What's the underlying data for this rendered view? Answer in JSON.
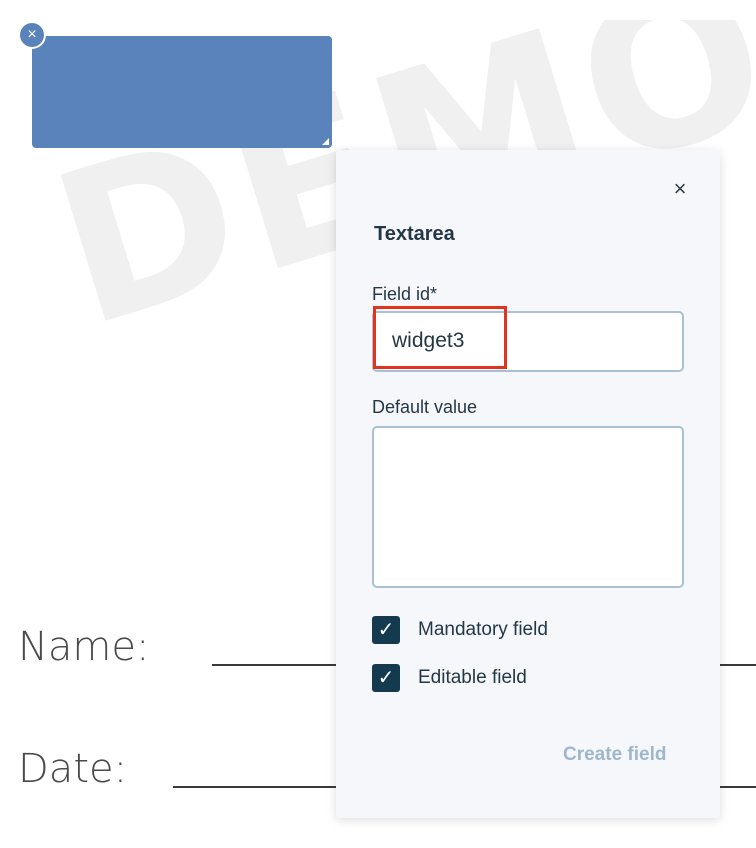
{
  "document": {
    "watermark": "DEMO D",
    "name_label": "Name:",
    "date_label": "Date:"
  },
  "widget": {
    "remove_icon": "×",
    "color": "#5a83bb"
  },
  "panel": {
    "close_icon": "×",
    "title": "Textarea",
    "field_id_label": "Field id",
    "required_marker": "*",
    "field_id_value": "widget3",
    "default_value_label": "Default value",
    "default_value": "",
    "checkboxes": [
      {
        "label": "Mandatory field",
        "checked": true
      },
      {
        "label": "Editable field",
        "checked": true
      }
    ],
    "check_glyph": "✓",
    "create_button": "Create field"
  },
  "colors": {
    "accent": "#133a4e",
    "highlight": "#e2331f",
    "disabled_text": "#9eb7cc"
  }
}
